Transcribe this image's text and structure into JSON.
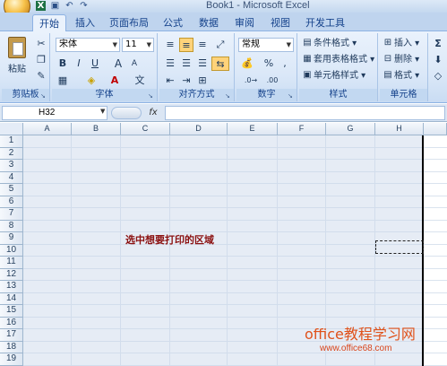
{
  "window": {
    "title": "Book1 - Microsoft Excel"
  },
  "tabs": [
    "开始",
    "插入",
    "页面布局",
    "公式",
    "数据",
    "审阅",
    "视图",
    "开发工具"
  ],
  "ribbon": {
    "clipboard": {
      "label": "剪贴板",
      "paste": "粘贴"
    },
    "font": {
      "label": "字体",
      "name": "宋体",
      "size": "11",
      "bold": "B",
      "italic": "I",
      "underline": "U",
      "grow": "A",
      "shrink": "A"
    },
    "alignment": {
      "label": "对齐方式"
    },
    "number": {
      "label": "数字",
      "format": "常规",
      "percent": "%",
      "comma": ","
    },
    "styles": {
      "label": "样式",
      "conditional": "条件格式",
      "table": "套用表格格式",
      "cell": "单元格样式"
    },
    "cells": {
      "label": "单元格",
      "insert": "插入",
      "delete": "删除",
      "format": "格式"
    }
  },
  "formula_bar": {
    "cell_ref": "H32",
    "fx": "fx",
    "value": ""
  },
  "sheet": {
    "columns": [
      "A",
      "B",
      "C",
      "D",
      "E",
      "F",
      "G",
      "H"
    ],
    "rows": [
      "1",
      "2",
      "3",
      "4",
      "5",
      "6",
      "7",
      "8",
      "9",
      "10",
      "11",
      "12",
      "13",
      "14",
      "15",
      "16",
      "17",
      "18",
      "19"
    ],
    "note": "选中想要打印的区域"
  },
  "watermark": {
    "line1": "office教程学习网",
    "line2": "www.office68.com"
  }
}
